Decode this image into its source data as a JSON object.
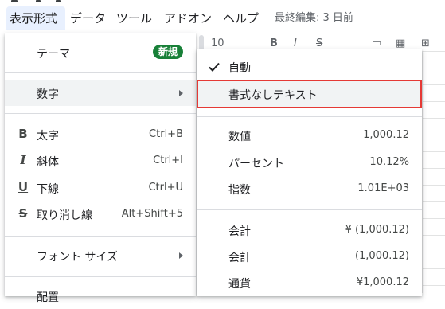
{
  "menubar": {
    "items": [
      {
        "label": "表示形式",
        "active": true
      },
      {
        "label": "データ"
      },
      {
        "label": "ツール"
      },
      {
        "label": "アドオン"
      },
      {
        "label": "ヘルプ"
      }
    ],
    "last_edit": "最終編集: 3 日前"
  },
  "toolbar": {
    "font_size": "10",
    "bold": "B",
    "italic": "I",
    "strike": "S"
  },
  "main_menu": {
    "theme": {
      "label": "テーマ",
      "badge": "新規"
    },
    "number": {
      "label": "数字"
    },
    "bold": {
      "icon": "B",
      "label": "太字",
      "shortcut": "Ctrl+B"
    },
    "italic": {
      "icon": "I",
      "label": "斜体",
      "shortcut": "Ctrl+I"
    },
    "underline": {
      "icon": "U",
      "label": "下線",
      "shortcut": "Ctrl+U"
    },
    "strikethrough": {
      "icon": "S",
      "label": "取り消し線",
      "shortcut": "Alt+Shift+5"
    },
    "font_size": {
      "label": "フォント サイズ"
    },
    "partial": {
      "label": "配置"
    }
  },
  "sub_menu": {
    "automatic": {
      "label": "自動"
    },
    "plain_text": {
      "label": "書式なしテキスト"
    },
    "number": {
      "label": "数値",
      "value": "1,000.12"
    },
    "percent": {
      "label": "パーセント",
      "value": "10.12%"
    },
    "scientific": {
      "label": "指数",
      "value": "1.01E+03"
    },
    "accounting": {
      "label": "会計",
      "value": "¥ (1,000.12)"
    },
    "financial": {
      "label": "会計",
      "value": "(1,000.12)"
    },
    "currency": {
      "label": "通貨",
      "value": "¥1,000.12"
    }
  },
  "colors": {
    "active_menu_bg": "#e8f0fe",
    "badge_green": "#188038",
    "highlight_red": "#e53935",
    "hover_gray": "#f1f3f4"
  }
}
